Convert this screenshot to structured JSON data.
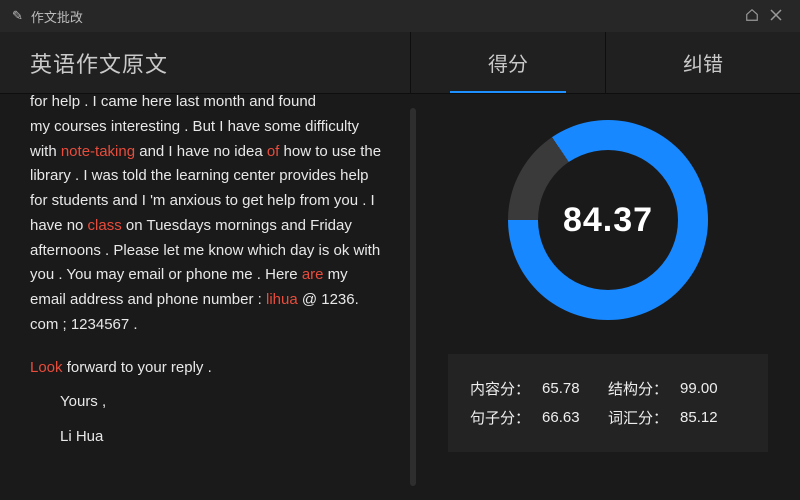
{
  "titlebar": {
    "icon": "✎",
    "title": "作文批改"
  },
  "header": {
    "left_title": "英语作文原文",
    "tab_score": "得分",
    "tab_corrections": "纠错"
  },
  "essay": {
    "cut_line": "for help . I came here last month and found",
    "line1a": "my courses interesting . But I have some",
    "line2a": "difficulty with ",
    "err_note": "note-taking",
    "line2b": " and I have no idea ",
    "err_of": "of",
    "line3a": " how to use the library . I was told the learning center provides help for students and I 'm anxious to get help from you . I have no ",
    "err_class": "class",
    "line4a": " on Tuesdays mornings and Friday afternoons . Please let me know which day is ok with you . You may email or phone me . Here ",
    "err_are": "are",
    "line5a": " my email address and phone number : ",
    "err_lihua": "lihua",
    "line5b": " @ 1236. com ; 1234567 .",
    "err_look": "Look",
    "line6a": " forward to your reply .",
    "sig1": "Yours ,",
    "sig2": "Li Hua"
  },
  "score": {
    "total": "84.37",
    "content_label": "内容分：",
    "content_val": "65.78",
    "structure_label": "结构分：",
    "structure_val": "99.00",
    "sentence_label": "句子分：",
    "sentence_val": "66.63",
    "vocab_label": "词汇分：",
    "vocab_val": "85.12"
  }
}
